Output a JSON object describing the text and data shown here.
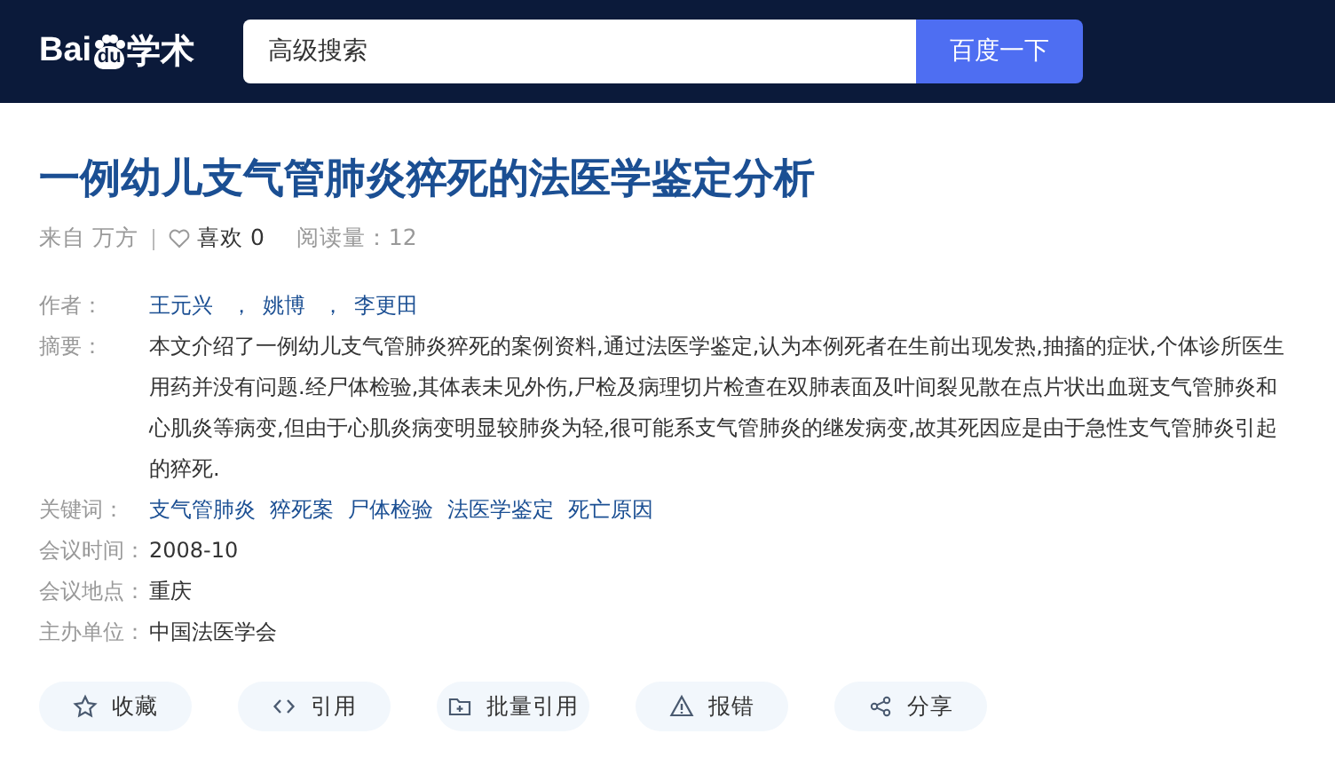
{
  "header": {
    "logo": {
      "left": "Bai",
      "paw": "du",
      "right": "学术"
    },
    "search": {
      "placeholder": "高级搜索"
    },
    "search_button": "百度一下"
  },
  "title": "一例幼儿支气管肺炎猝死的法医学鉴定分析",
  "meta": {
    "source": "来自 万方",
    "like_label": "喜欢 0",
    "reads": "阅读量：12"
  },
  "authors": {
    "label": "作者：",
    "names": [
      "王元兴",
      "姚博",
      "李更田"
    ],
    "separator": "，"
  },
  "abstract": {
    "label": "摘要：",
    "text": "本文介绍了一例幼儿支气管肺炎猝死的案例资料,通过法医学鉴定,认为本例死者在生前出现发热,抽搐的症状,个体诊所医生用药并没有问题.经尸体检验,其体表未见外伤,尸检及病理切片检查在双肺表面及叶间裂见散在点片状出血斑支气管肺炎和心肌炎等病变,但由于心肌炎病变明显较肺炎为轻,很可能系支气管肺炎的继发病变,故其死因应是由于急性支气管肺炎引起的猝死."
  },
  "keywords": {
    "label": "关键词：",
    "items": [
      "支气管肺炎",
      "猝死案",
      "尸体检验",
      "法医学鉴定",
      "死亡原因"
    ]
  },
  "fields": [
    {
      "label": "会议时间：",
      "value": "2008-10"
    },
    {
      "label": "会议地点：",
      "value": "重庆"
    },
    {
      "label": "主办单位：",
      "value": "中国法医学会"
    }
  ],
  "actions": [
    {
      "kind": "star",
      "label": "收藏"
    },
    {
      "kind": "code",
      "label": "引用"
    },
    {
      "kind": "folder",
      "label": "批量引用"
    },
    {
      "kind": "warning",
      "label": "报错"
    },
    {
      "kind": "share",
      "label": "分享"
    }
  ]
}
